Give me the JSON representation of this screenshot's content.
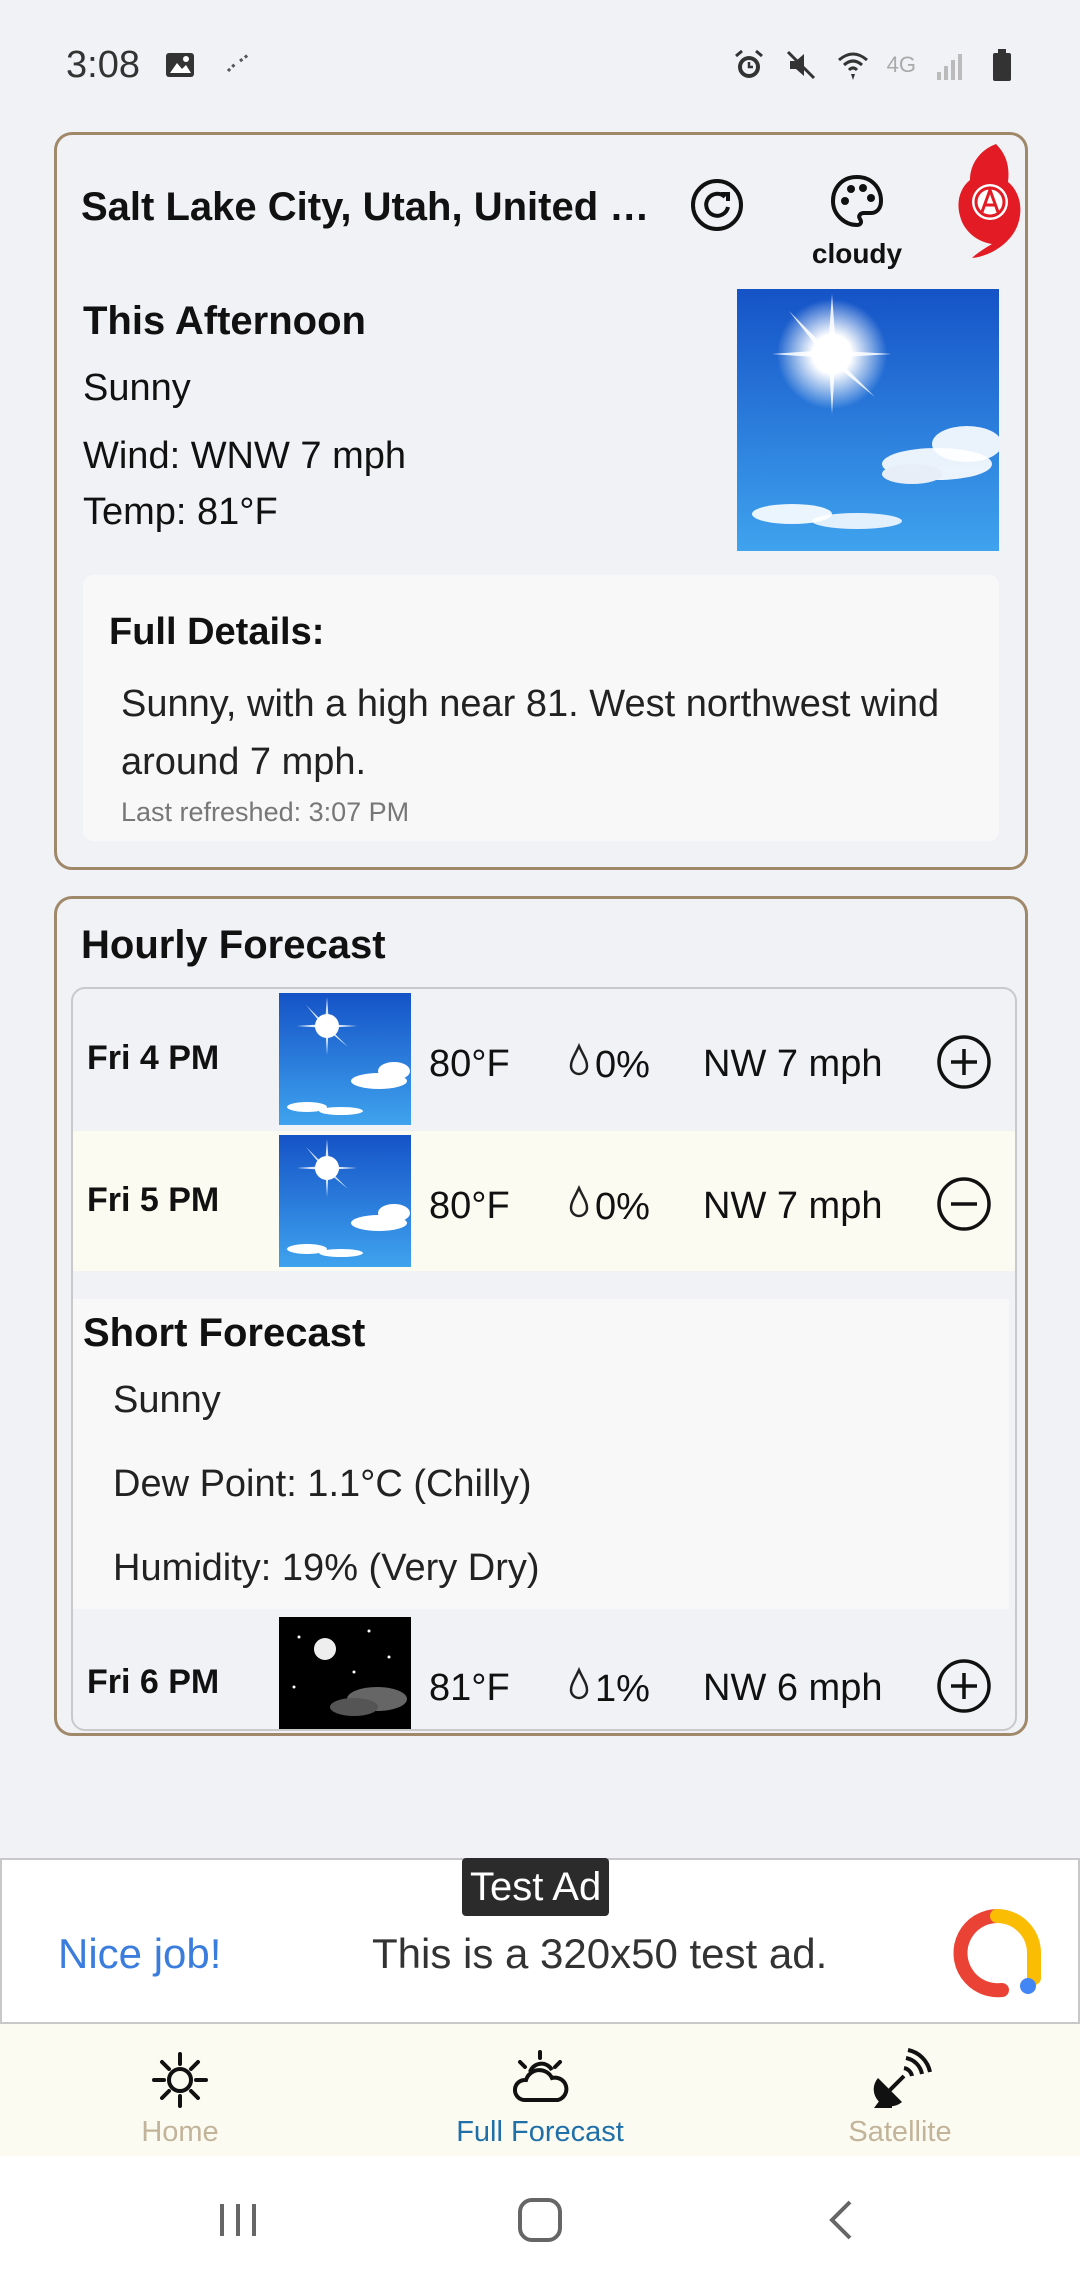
{
  "status_bar": {
    "time": "3:08",
    "left_icons": [
      "gallery-icon",
      "sync-icon"
    ],
    "right_icons": [
      "alarm-icon",
      "mute-icon",
      "wifi-icon",
      "4g-icon",
      "signal-icon",
      "battery-icon"
    ],
    "network_label": "4G"
  },
  "header": {
    "location": "Salt Lake City, Utah, United St...",
    "refresh_icon": "refresh-icon",
    "theme_icon": "palette-icon",
    "theme_label": "cloudy"
  },
  "current": {
    "title": "This Afternoon",
    "short": "Sunny",
    "wind": "Wind: WNW 7 mph",
    "temp": "Temp: 81°F",
    "details_title": "Full Details:",
    "details_text": "Sunny, with a high near 81. West northwest wind around 7 mph.",
    "last_refreshed": "Last refreshed: 3:07 PM"
  },
  "hourly": {
    "title": "Hourly Forecast",
    "rows": [
      {
        "time": "Fri 4 PM",
        "temp": "80°F",
        "precip": "0%",
        "wind": "NW 7 mph",
        "toggle": "plus-circle-icon",
        "image": "sunny"
      },
      {
        "time": "Fri 5 PM",
        "temp": "80°F",
        "precip": "0%",
        "wind": "NW 7 mph",
        "toggle": "minus-circle-icon",
        "image": "sunny"
      },
      {
        "time": "Fri 6 PM",
        "temp": "81°F",
        "precip": "1%",
        "wind": "NW 6 mph",
        "toggle": "plus-circle-icon",
        "image": "night-clear"
      }
    ],
    "expanded": {
      "title": "Short Forecast",
      "short": "Sunny",
      "dew_point": "Dew Point: 1.1°C (Chilly)",
      "humidity": "Humidity: 19% (Very Dry)"
    }
  },
  "ad": {
    "tag": "Test Ad",
    "nice": "Nice job!",
    "text": "This is a 320x50 test ad."
  },
  "nav": {
    "items": [
      {
        "label": "Home",
        "icon": "sun-icon",
        "active": false
      },
      {
        "label": "Full Forecast",
        "icon": "partly-cloudy-icon",
        "active": true
      },
      {
        "label": "Satellite",
        "icon": "satellite-dish-icon",
        "active": false
      }
    ]
  },
  "colors": {
    "card_border": "#a0896a",
    "nav_active": "#1f6fa8",
    "nav_inactive": "#c2b49a",
    "expanded_row": "#fcfbf1"
  }
}
